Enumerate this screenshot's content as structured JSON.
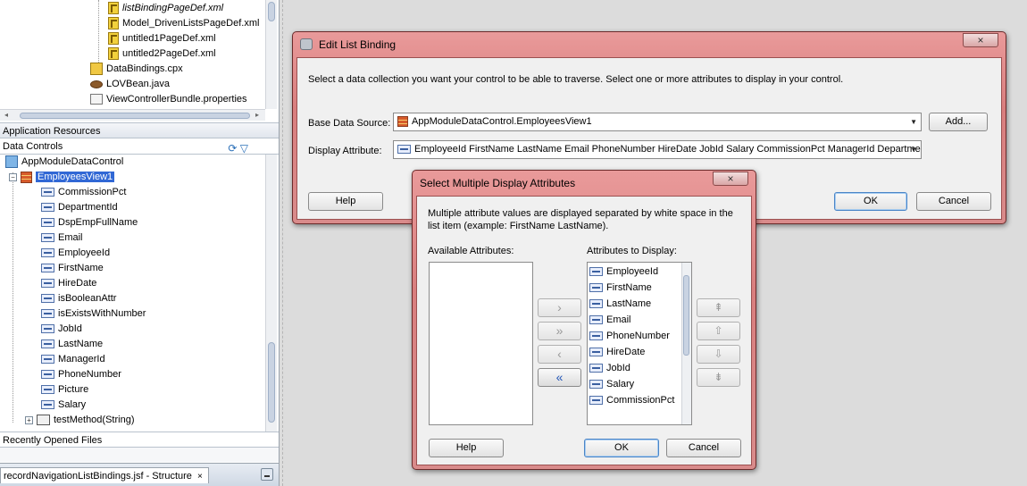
{
  "left_panel": {
    "files": [
      {
        "name": "listBindingPageDef.xml",
        "icon": "page-def-xml-icon"
      },
      {
        "name": "Model_DrivenListsPageDef.xml",
        "icon": "page-def-xml-icon"
      },
      {
        "name": "untitled1PageDef.xml",
        "icon": "page-def-xml-icon"
      },
      {
        "name": "untitled2PageDef.xml",
        "icon": "page-def-xml-icon"
      },
      {
        "name": "DataBindings.cpx",
        "icon": "cpx-file-icon"
      },
      {
        "name": "LOVBean.java",
        "icon": "java-bean-icon"
      },
      {
        "name": "ViewControllerBundle.properties",
        "icon": "properties-file-icon"
      }
    ],
    "application_resources": "Application Resources",
    "data_controls": "Data Controls",
    "data_control": "AppModuleDataControl",
    "view": "EmployeesView1",
    "view_attributes": [
      "CommissionPct",
      "DepartmentId",
      "DspEmpFullName",
      "Email",
      "EmployeeId",
      "FirstName",
      "HireDate",
      "isBooleanAttr",
      "isExistsWithNumber",
      "JobId",
      "LastName",
      "ManagerId",
      "PhoneNumber",
      "Picture",
      "Salary"
    ],
    "method": "testMethod(String)",
    "recently_opened": "Recently Opened Files",
    "structure_tab": "recordNavigationListBindings.jsf - Structure",
    "structure_close": "×"
  },
  "edit_list_binding": {
    "title": "Edit List Binding",
    "close": "×",
    "instructions": "Select a data collection you want your control to be able to traverse. Select one or more attributes to display in your control.",
    "base_data_source_label": "Base Data Source:",
    "base_data_source_value": "AppModuleDataControl.EmployeesView1",
    "add_button": "Add...",
    "display_attribute_label": "Display Attribute:",
    "display_attribute_value": "EmployeeId FirstName LastName Email PhoneNumber HireDate JobId Salary CommissionPct ManagerId Departme...",
    "help_button": "Help",
    "ok_button": "OK",
    "cancel_button": "Cancel"
  },
  "select_multiple": {
    "title": "Select Multiple Display Attributes",
    "close": "×",
    "description": "Multiple attribute values are displayed separated by white space in the list item (example: FirstName LastName).",
    "available_label": "Available Attributes:",
    "display_label": "Attributes to Display:",
    "display_items": [
      "EmployeeId",
      "FirstName",
      "LastName",
      "Email",
      "PhoneNumber",
      "HireDate",
      "JobId",
      "Salary",
      "CommissionPct"
    ],
    "shuttle_buttons": [
      "›",
      "»",
      "‹",
      "«"
    ],
    "order_buttons": [
      "⇞",
      "⇧",
      "⇩",
      "⇟"
    ],
    "help_button": "Help",
    "ok_button": "OK",
    "cancel_button": "Cancel"
  },
  "colors": {
    "dialog_frame": "#d98b8b",
    "selection": "#3168d5",
    "active_shuttle": "#2457b8"
  }
}
